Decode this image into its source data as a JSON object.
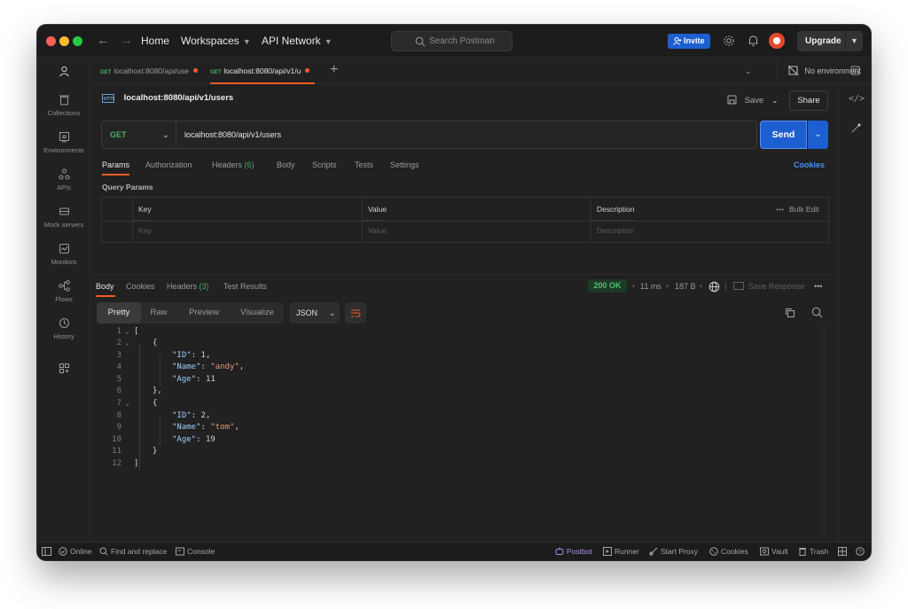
{
  "colors": {
    "accent": "#ef5b25",
    "primary_button": "#1d5fd1",
    "method_get": "#4cae67",
    "status_ok": "#4cc36e",
    "link": "#4a8df5"
  },
  "titlebar": {
    "home": "Home",
    "workspaces": "Workspaces",
    "api_network": "API Network",
    "search_placeholder": "Search Postman",
    "invite": "Invite",
    "upgrade": "Upgrade"
  },
  "sidebar": {
    "items": [
      {
        "label": "",
        "icon": "account-icon"
      },
      {
        "label": "Collections",
        "icon": "trash-can-icon"
      },
      {
        "label": "Environments",
        "icon": "environment-icon"
      },
      {
        "label": "APIs",
        "icon": "apis-icon"
      },
      {
        "label": "Mock servers",
        "icon": "mock-server-icon"
      },
      {
        "label": "Monitors",
        "icon": "monitor-icon"
      },
      {
        "label": "Flows",
        "icon": "flows-icon"
      },
      {
        "label": "History",
        "icon": "history-icon"
      },
      {
        "label": "",
        "icon": "add-workbench-icon"
      }
    ]
  },
  "tabs": [
    {
      "method": "GET",
      "label": "localhost:8080/api/use",
      "active": false
    },
    {
      "method": "GET",
      "label": "localhost:8080/api/v1/u",
      "active": true
    }
  ],
  "environment": "No environment",
  "request": {
    "title": "localhost:8080/api/v1/users",
    "save": "Save",
    "share": "Share",
    "method": "GET",
    "url": "localhost:8080/api/v1/users",
    "send": "Send",
    "tabs": {
      "params": "Params",
      "authorization": "Authorization",
      "headers": "Headers",
      "headers_count": "(6)",
      "body": "Body",
      "scripts": "Scripts",
      "tests": "Tests",
      "settings": "Settings"
    },
    "cookies": "Cookies",
    "query_params_label": "Query Params",
    "table": {
      "headers": {
        "key": "Key",
        "value": "Value",
        "description": "Description",
        "bulk_edit": "Bulk Edit"
      },
      "placeholders": {
        "key": "Key",
        "value": "Value",
        "description": "Description"
      }
    }
  },
  "response": {
    "tabs": {
      "body": "Body",
      "cookies": "Cookies",
      "headers": "Headers",
      "headers_count": "(3)",
      "test_results": "Test Results"
    },
    "status": "200 OK",
    "time": "11 ms",
    "size": "187 B",
    "save_response": "Save Response",
    "views": [
      "Pretty",
      "Raw",
      "Preview",
      "Visualize"
    ],
    "format": "JSON",
    "lines": [
      "1",
      "2",
      "3",
      "4",
      "5",
      "6",
      "7",
      "8",
      "9",
      "10",
      "11",
      "12"
    ],
    "code": {
      "l1": "[",
      "l2": "{",
      "id_key": "\"ID\"",
      "name_key": "\"Name\"",
      "age_key": "\"Age\"",
      "id1": "1",
      "name1": "\"andy\"",
      "age1": "11",
      "l6": "},",
      "l7": "{",
      "id2": "2",
      "name2": "\"tom\"",
      "age2": "19",
      "l11": "}",
      "l12": "]"
    }
  },
  "statusbar": {
    "online": "Online",
    "find_replace": "Find and replace",
    "console": "Console",
    "postbot": "Postbot",
    "runner": "Runner",
    "start_proxy": "Start Proxy",
    "cookies": "Cookies",
    "vault": "Vault",
    "trash": "Trash"
  }
}
